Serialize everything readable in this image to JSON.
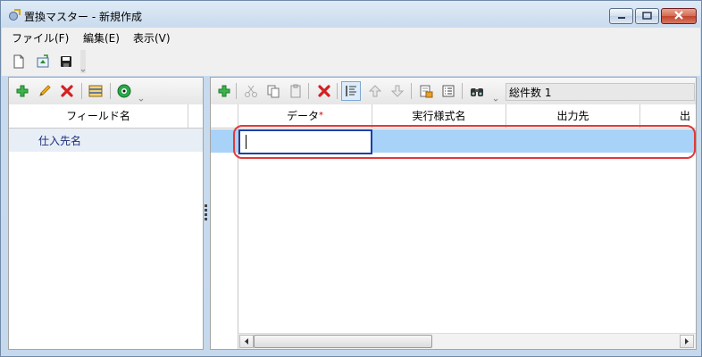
{
  "window": {
    "title": "置換マスター - 新規作成"
  },
  "menu": {
    "items": [
      {
        "label": "ファイル(F)"
      },
      {
        "label": "編集(E)"
      },
      {
        "label": "表示(V)"
      }
    ]
  },
  "toolbar": {
    "icons": [
      "new-file-icon",
      "open-file-icon",
      "save-icon"
    ]
  },
  "left_panel": {
    "toolbar_icons": [
      "add-icon",
      "edit-pencil-icon",
      "delete-icon",
      "table-icon",
      "eye-icon"
    ],
    "column_header": "フィールド名",
    "rows": [
      {
        "label": "仕入先名"
      }
    ]
  },
  "right_panel": {
    "toolbar_icons": [
      "add-icon",
      "cut-icon",
      "copy-icon",
      "paste-icon",
      "delete-icon",
      "auto-number-icon",
      "move-up-icon",
      "move-down-icon",
      "export-icon",
      "list-icon",
      "find-icon"
    ],
    "total_count": "総件数 1",
    "columns": [
      {
        "label": "データ",
        "required": "*"
      },
      {
        "label": "実行様式名"
      },
      {
        "label": "出力先"
      },
      {
        "label": "出力"
      }
    ],
    "rows": [
      {
        "data": "",
        "format": "",
        "output": ""
      }
    ]
  },
  "colors": {
    "selection": "#a8d2f8",
    "highlight": "#e03a3a",
    "edit_border": "#1a3faa"
  }
}
